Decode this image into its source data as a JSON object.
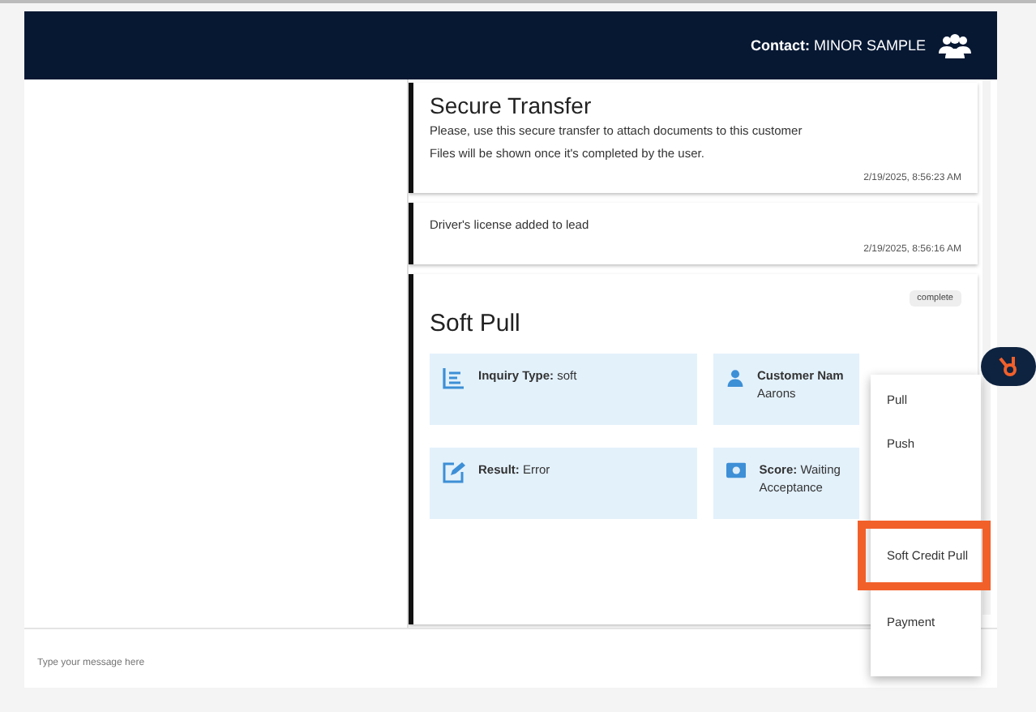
{
  "header": {
    "contact_label": "Contact:",
    "contact_name": "MINOR SAMPLE"
  },
  "feed": [
    {
      "kind": "message",
      "title": "Secure Transfer",
      "lines": [
        "Please, use this secure transfer to attach documents to this customer",
        "Files will be shown once it's completed by the user."
      ],
      "time": "2/19/2025, 8:56:23 AM"
    },
    {
      "kind": "message",
      "lines": [
        "Driver's license added to lead"
      ],
      "time": "2/19/2025, 8:56:16 AM"
    },
    {
      "kind": "softpull",
      "title": "Soft Pull",
      "badge": "complete",
      "fields": [
        {
          "label": "Inquiry Type:",
          "value": "soft"
        },
        {
          "label": "Customer Nam",
          "value": "Aarons"
        },
        {
          "label": "Result:",
          "value": "Error"
        },
        {
          "label": "Score:",
          "value": "Waiting Acceptance"
        }
      ]
    }
  ],
  "menu": [
    {
      "label": "Pull",
      "highlighted": false
    },
    {
      "label": "Push",
      "highlighted": false
    },
    {
      "label": "Soft Credit Pull",
      "highlighted": true
    },
    {
      "label": "Payment",
      "highlighted": false
    }
  ],
  "composer": {
    "placeholder": "Type your message here"
  }
}
